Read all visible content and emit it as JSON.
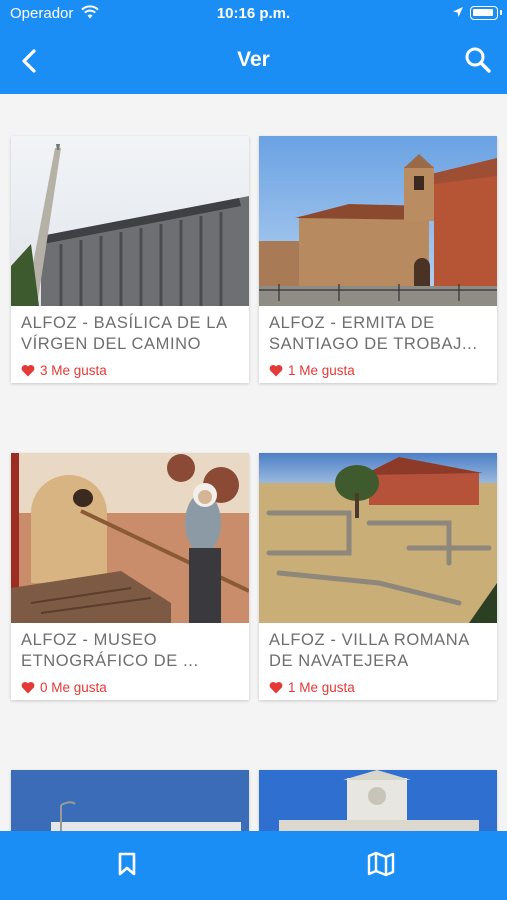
{
  "status_bar": {
    "carrier": "Operador",
    "time": "10:16 p.m."
  },
  "nav": {
    "title": "Ver"
  },
  "cards": [
    {
      "title": "ALFOZ - BASÍLICA DE LA VÍRGEN DEL CAMINO",
      "likes": "3 Me gusta"
    },
    {
      "title": "ALFOZ - ERMITA DE SANTIAGO DE TROBAJ...",
      "likes": "1 Me gusta"
    },
    {
      "title": "ALFOZ - MUSEO ETNOGRÁFICO DE ...",
      "likes": "0 Me gusta"
    },
    {
      "title": "ALFOZ - VILLA ROMANA DE NAVATEJERA",
      "likes": "1 Me gusta"
    }
  ],
  "colors": {
    "primary": "#1a8ef5",
    "like": "#e53935",
    "text_muted": "#6e6e6e"
  },
  "icons": {
    "back": "chevron-left-icon",
    "search": "search-icon",
    "like": "heart-icon",
    "tab_saved": "bookmark-icon",
    "tab_map": "map-icon"
  }
}
